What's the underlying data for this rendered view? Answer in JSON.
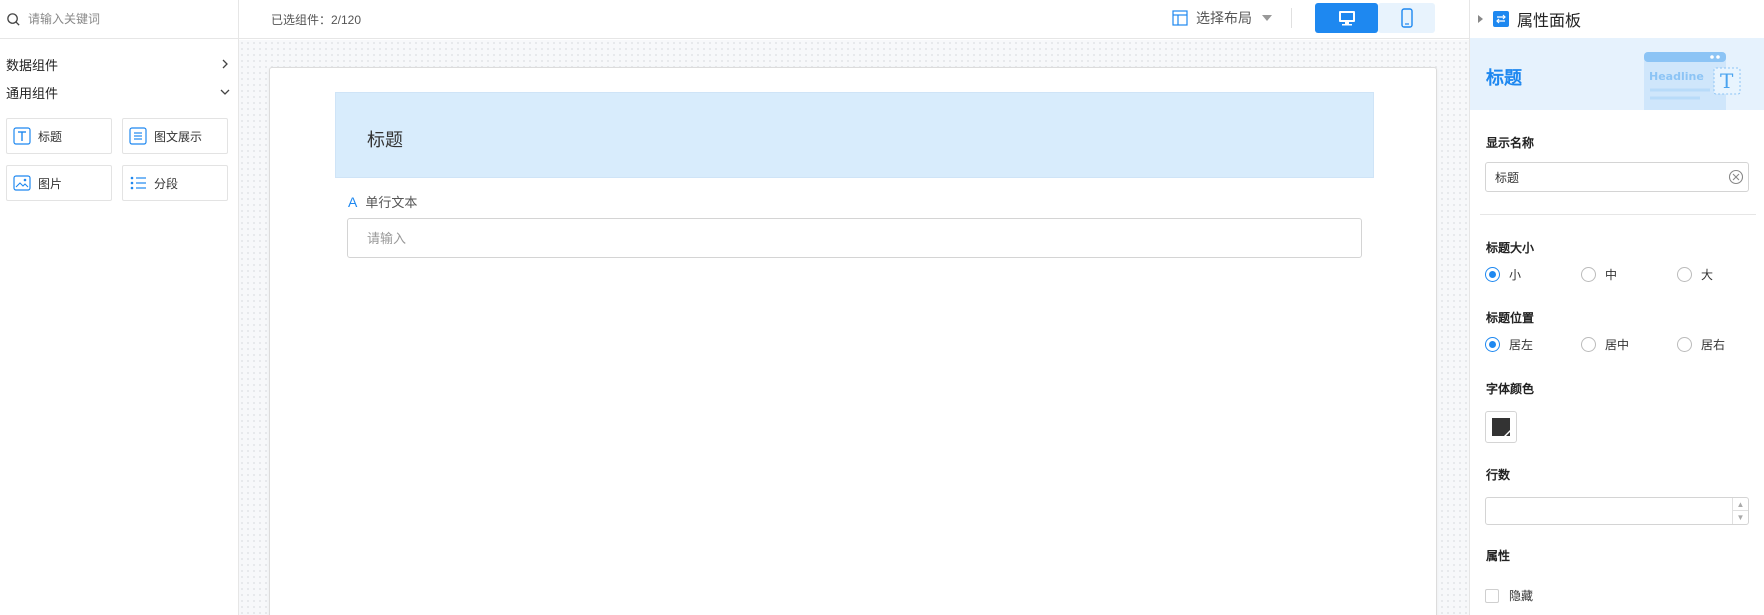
{
  "left": {
    "search_placeholder": "请输入关键词",
    "groups": [
      {
        "label": "数据组件",
        "state": "collapsed"
      },
      {
        "label": "通用组件",
        "state": "expanded"
      }
    ],
    "components": [
      {
        "label": "标题",
        "icon": "title-t-icon"
      },
      {
        "label": "图文展示",
        "icon": "image-text-icon"
      },
      {
        "label": "图片",
        "icon": "image-icon"
      },
      {
        "label": "分段",
        "icon": "list-segment-icon"
      }
    ]
  },
  "toolbar": {
    "selected_count": "已选组件：2/120",
    "layout_label": "选择布局",
    "device_active": "desktop"
  },
  "canvas": {
    "title_text": "标题",
    "field_label": "单行文本",
    "field_placeholder": "请输入"
  },
  "right": {
    "panel_title": "属性面板",
    "banner_title": "标题",
    "banner_art_text": "Headline",
    "display_name_label": "显示名称",
    "display_name_value": "标题",
    "size_label": "标题大小",
    "size_options": [
      "小",
      "中",
      "大"
    ],
    "size_selected": "小",
    "position_label": "标题位置",
    "position_options": [
      "居左",
      "居中",
      "居右"
    ],
    "position_selected": "居左",
    "color_label": "字体颜色",
    "font_color": "#333333",
    "rows_label": "行数",
    "rows_value": "",
    "attr_label": "属性",
    "hidden_label": "隐藏",
    "hidden_checked": false
  },
  "colors": {
    "accent": "#1e88f0",
    "title_block_bg": "#d8ecfc"
  }
}
